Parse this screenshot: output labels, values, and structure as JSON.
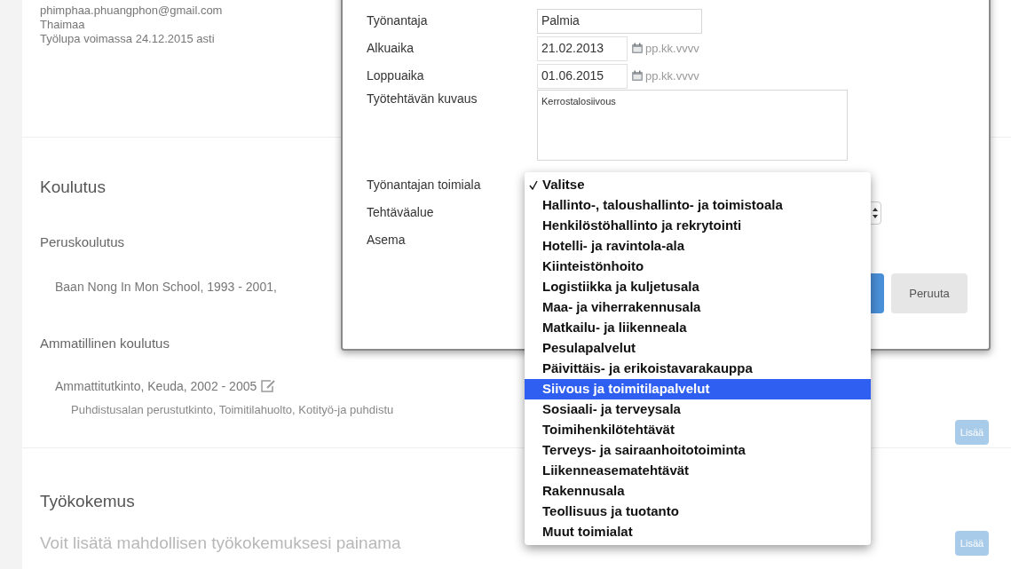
{
  "profile": {
    "lines": [
      "phimphaa.phuangphon@gmail.com",
      "Thaimaa",
      "Työlupa voimassa 24.12.2015 asti"
    ]
  },
  "education": {
    "title": "Koulutus",
    "basic_title": "Peruskoulutus",
    "basic_entry": "Baan Nong In Mon School, 1993 - 2001,",
    "vocational_title": "Ammatillinen koulutus",
    "vocational_entry": "Ammattitutkinto, Keuda, 2002 - 2005",
    "vocational_detail": "Puhdistusalan perustutkinto, Toimitilahuolto, Kotityö-ja puhdistu",
    "add_button": "Lisää"
  },
  "work": {
    "title": "Työkokemus",
    "hint": "Voit lisätä mahdollisen työkokemuksesi painama",
    "add_button": "Lisää"
  },
  "modal": {
    "fields": [
      {
        "kind": "text",
        "label": "Työnantaja",
        "value": "Palmia"
      },
      {
        "kind": "date",
        "label": "Alkuaika",
        "value": "21.02.2013",
        "placeholder": "pp.kk.vvvv"
      },
      {
        "kind": "date",
        "label": "Loppuaika",
        "value": "01.06.2015",
        "placeholder": "pp.kk.vvvv"
      },
      {
        "kind": "textarea",
        "label": "Työtehtävän kuvaus",
        "value": "Kerrostalosiivous"
      },
      {
        "kind": "label",
        "label": "Työnantajan toimiala"
      },
      {
        "kind": "select",
        "label": "Tehtäväalue"
      },
      {
        "kind": "label",
        "label": "Asema"
      }
    ],
    "cancel_button": "Peruuta"
  },
  "dropdown": {
    "options": [
      {
        "label": "Valitse",
        "checked": true,
        "selected": false
      },
      {
        "label": "Hallinto-, taloushallinto- ja toimistoala",
        "checked": false,
        "selected": false
      },
      {
        "label": "Henkilöstöhallinto ja rekrytointi",
        "checked": false,
        "selected": false
      },
      {
        "label": "Hotelli- ja ravintola-ala",
        "checked": false,
        "selected": false
      },
      {
        "label": "Kiinteistönhoito",
        "checked": false,
        "selected": false
      },
      {
        "label": "Logistiikka ja kuljetusala",
        "checked": false,
        "selected": false
      },
      {
        "label": "Maa- ja viherrakennusala",
        "checked": false,
        "selected": false
      },
      {
        "label": "Matkailu- ja liikenneala",
        "checked": false,
        "selected": false
      },
      {
        "label": "Pesulapalvelut",
        "checked": false,
        "selected": false
      },
      {
        "label": "Päivittäis- ja erikoistavarakauppa",
        "checked": false,
        "selected": false
      },
      {
        "label": "Siivous ja toimitilapalvelut",
        "checked": false,
        "selected": true
      },
      {
        "label": "Sosiaali- ja terveysala",
        "checked": false,
        "selected": false
      },
      {
        "label": "Toimihenkilötehtävät",
        "checked": false,
        "selected": false
      },
      {
        "label": "Terveys- ja sairaanhoitotoiminta",
        "checked": false,
        "selected": false
      },
      {
        "label": "Liikenneasematehtävät",
        "checked": false,
        "selected": false
      },
      {
        "label": "Rakennusala",
        "checked": false,
        "selected": false
      },
      {
        "label": "Teollisuus ja tuotanto",
        "checked": false,
        "selected": false
      },
      {
        "label": "Muut toimialat",
        "checked": false,
        "selected": false
      }
    ]
  }
}
